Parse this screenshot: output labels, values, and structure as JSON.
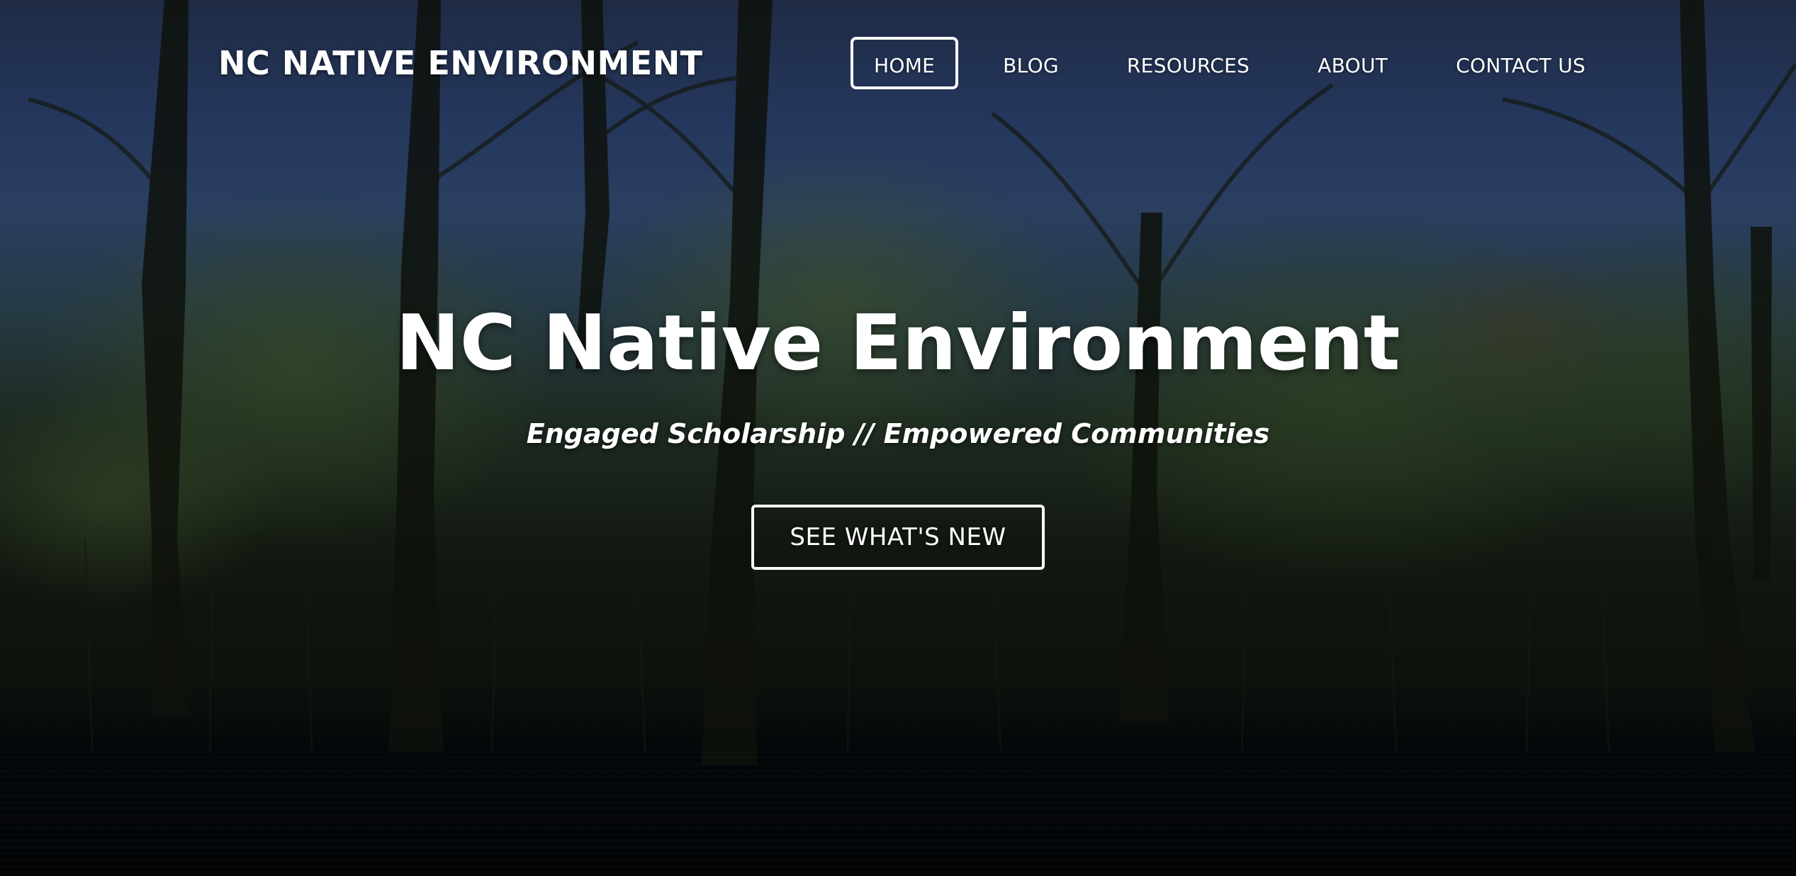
{
  "site": {
    "brand": "NC NATIVE ENVIRONMENT"
  },
  "nav": {
    "items": [
      {
        "label": "HOME",
        "active": true
      },
      {
        "label": "BLOG",
        "active": false
      },
      {
        "label": "RESOURCES",
        "active": false
      },
      {
        "label": "ABOUT",
        "active": false
      },
      {
        "label": "CONTACT US",
        "active": false
      }
    ]
  },
  "hero": {
    "title": "NC Native Environment",
    "subtitle": "Engaged Scholarship // Empowered Communities",
    "cta_label": "SEE WHAT'S NEW",
    "background": "forest-swamp-photo"
  },
  "colors": {
    "text": "#ffffff",
    "sky": "#3f5f95",
    "foliage": "#567634",
    "water": "#05080b"
  }
}
